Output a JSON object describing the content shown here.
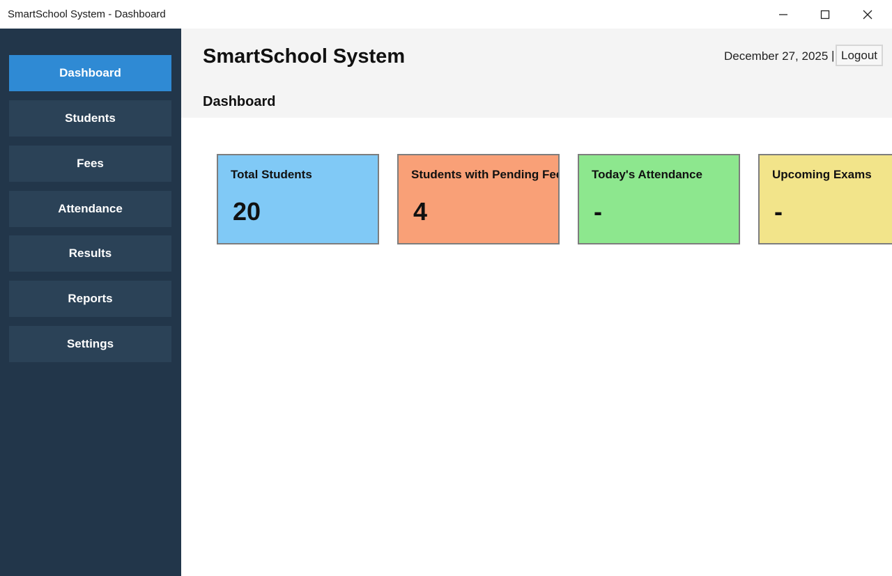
{
  "window": {
    "title": "SmartSchool System - Dashboard"
  },
  "sidebar": {
    "items": [
      {
        "label": "Dashboard",
        "active": true
      },
      {
        "label": "Students",
        "active": false
      },
      {
        "label": "Fees",
        "active": false
      },
      {
        "label": "Attendance",
        "active": false
      },
      {
        "label": "Results",
        "active": false
      },
      {
        "label": "Reports",
        "active": false
      },
      {
        "label": "Settings",
        "active": false
      }
    ]
  },
  "header": {
    "app_title": "SmartSchool System",
    "page_title": "Dashboard",
    "date": "December 27, 2025",
    "separator": "|",
    "logout_label": "Logout"
  },
  "cards": [
    {
      "label": "Total Students",
      "value": "20",
      "color": "#80c9f6"
    },
    {
      "label": "Students with Pending Fees",
      "value": "4",
      "color": "#f9a077"
    },
    {
      "label": "Today's Attendance",
      "value": "-",
      "color": "#8de78e"
    },
    {
      "label": "Upcoming Exams",
      "value": "-",
      "color": "#f2e48a"
    }
  ],
  "colors": {
    "sidebar_bg": "#22364a",
    "nav_item_bg": "#2b4257",
    "nav_active_bg": "#2f8ad4"
  }
}
